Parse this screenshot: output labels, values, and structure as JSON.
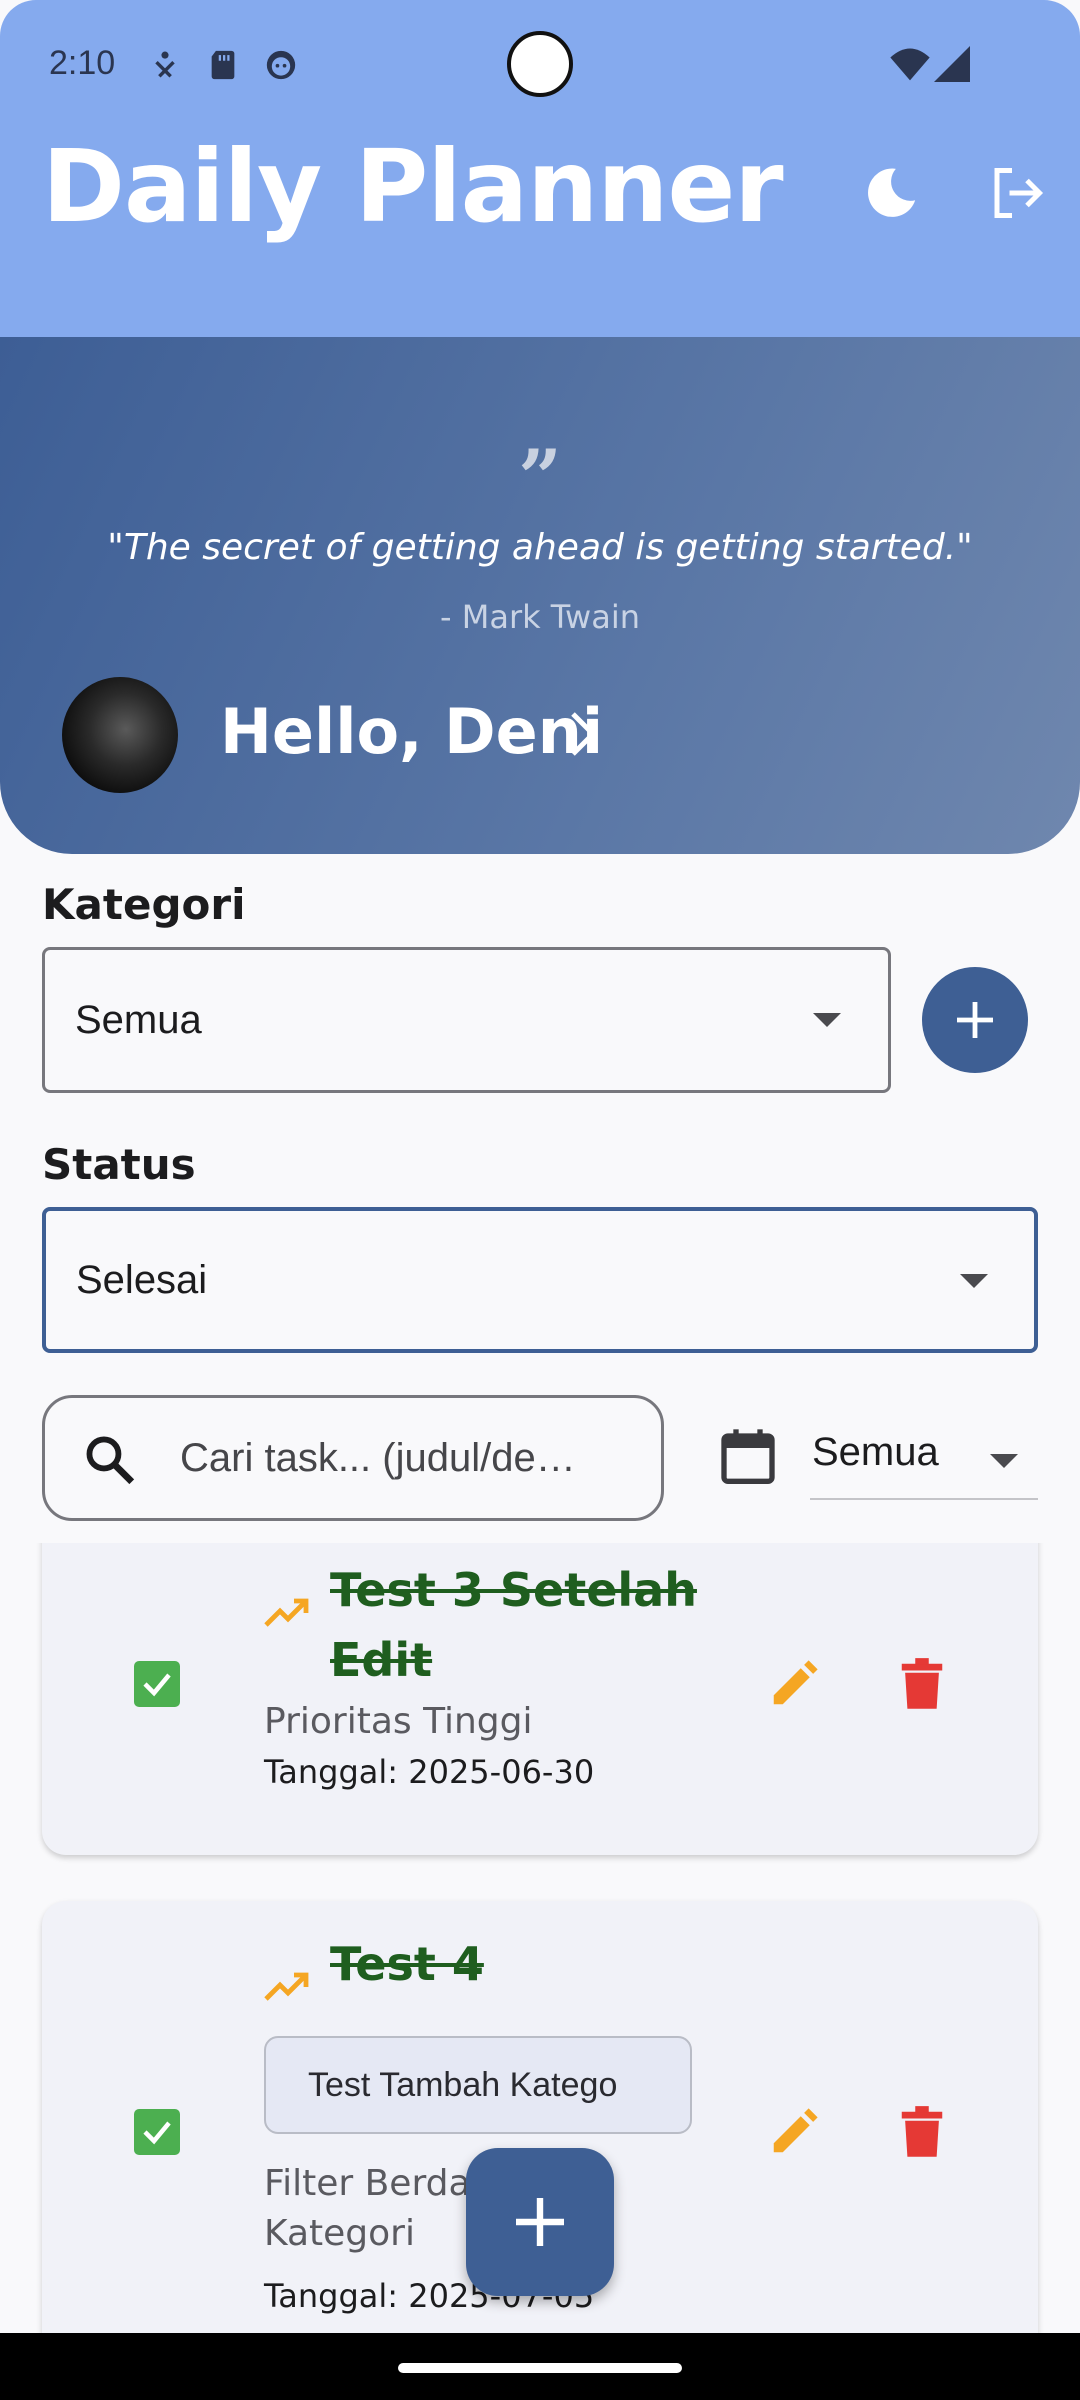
{
  "status_bar": {
    "time": "2:10"
  },
  "app_bar": {
    "title": "Daily Planner"
  },
  "quote": {
    "text": "\"The secret of getting ahead is getting started.\"",
    "author": "- Mark Twain"
  },
  "greeting": {
    "text": "Hello, Deni"
  },
  "filters": {
    "category_label": "Kategori",
    "category_value": "Semua",
    "status_label": "Status",
    "status_value": "Selesai",
    "search_placeholder": "Cari task... (judul/de…",
    "date_value": "Semua"
  },
  "tasks": [
    {
      "title_line1": "Test 3 Setelah",
      "title_line2": "Edit",
      "priority": "Prioritas Tinggi",
      "date": "Tanggal: 2025-06-30",
      "completed": true
    },
    {
      "title_line1": "Test 4",
      "chip": "Test Tambah Katego",
      "priority_line1": "Filter Berda",
      "priority_line2": "Kategori",
      "date": "Tanggal: 2025-07-05",
      "completed": true
    }
  ],
  "colors": {
    "appbar": "#85aaee",
    "primary": "#3e5f94",
    "check": "#4caf50",
    "edit": "#f5a623",
    "delete": "#e53935",
    "done_title": "#1f5e1f"
  }
}
